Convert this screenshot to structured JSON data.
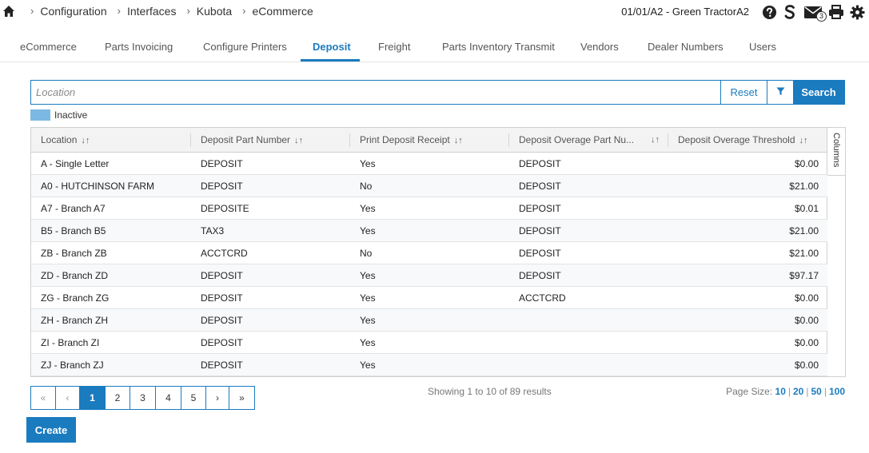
{
  "breadcrumb": [
    "Configuration",
    "Interfaces",
    "Kubota",
    "eCommerce"
  ],
  "header": {
    "store": "01/01/A2 - Green TractorA2",
    "mail_count": "3",
    "icons": [
      "home-icon",
      "help-icon",
      "s-logo-icon",
      "mail-icon",
      "print-icon",
      "gear-icon"
    ]
  },
  "tabs": [
    {
      "label": "eCommerce"
    },
    {
      "label": "Parts Invoicing"
    },
    {
      "label": "Configure Printers"
    },
    {
      "label": "Deposit",
      "active": true
    },
    {
      "label": "Freight"
    },
    {
      "label": "Parts Inventory Transmit"
    },
    {
      "label": "Vendors"
    },
    {
      "label": "Dealer Numbers"
    },
    {
      "label": "Users"
    }
  ],
  "search": {
    "placeholder": "Location",
    "value": "",
    "reset_label": "Reset",
    "search_label": "Search"
  },
  "legend": {
    "label": "Inactive",
    "color": "#7cb9e2"
  },
  "table": {
    "columns_label": "Columns",
    "sort_glyph": "↓↑",
    "headers": [
      "Location",
      "Deposit Part Number",
      "Print Deposit Receipt",
      "Deposit Overage Part Nu...",
      "Deposit Overage Threshold"
    ],
    "rows": [
      [
        "A - Single Letter",
        "DEPOSIT",
        "Yes",
        "DEPOSIT",
        "$0.00"
      ],
      [
        "A0 - HUTCHINSON FARM",
        "DEPOSIT",
        "No",
        "DEPOSIT",
        "$21.00"
      ],
      [
        "A7 - Branch A7",
        "DEPOSITE",
        "Yes",
        "DEPOSIT",
        "$0.01"
      ],
      [
        "B5 - Branch B5",
        "TAX3",
        "Yes",
        "DEPOSIT",
        "$21.00"
      ],
      [
        "ZB - Branch ZB",
        "ACCTCRD",
        "No",
        "DEPOSIT",
        "$21.00"
      ],
      [
        "ZD - Branch ZD",
        "DEPOSIT",
        "Yes",
        "DEPOSIT",
        "$97.17"
      ],
      [
        "ZG - Branch ZG",
        "DEPOSIT",
        "Yes",
        "ACCTCRD",
        "$0.00"
      ],
      [
        "ZH - Branch ZH",
        "DEPOSIT",
        "Yes",
        "",
        "$0.00"
      ],
      [
        "ZI - Branch ZI",
        "DEPOSIT",
        "Yes",
        "",
        "$0.00"
      ],
      [
        "ZJ - Branch ZJ",
        "DEPOSIT",
        "Yes",
        "",
        "$0.00"
      ]
    ]
  },
  "pagination": {
    "first": "«",
    "prev": "‹",
    "pages": [
      "1",
      "2",
      "3",
      "4",
      "5"
    ],
    "current": "1",
    "next": "›",
    "last": "»",
    "summary": "Showing 1 to 10 of 89 results",
    "page_size_label": "Page Size:",
    "page_sizes": [
      "10",
      "20",
      "50",
      "100"
    ]
  },
  "actions": {
    "create_label": "Create"
  },
  "colors": {
    "accent": "#1a7bbf"
  }
}
